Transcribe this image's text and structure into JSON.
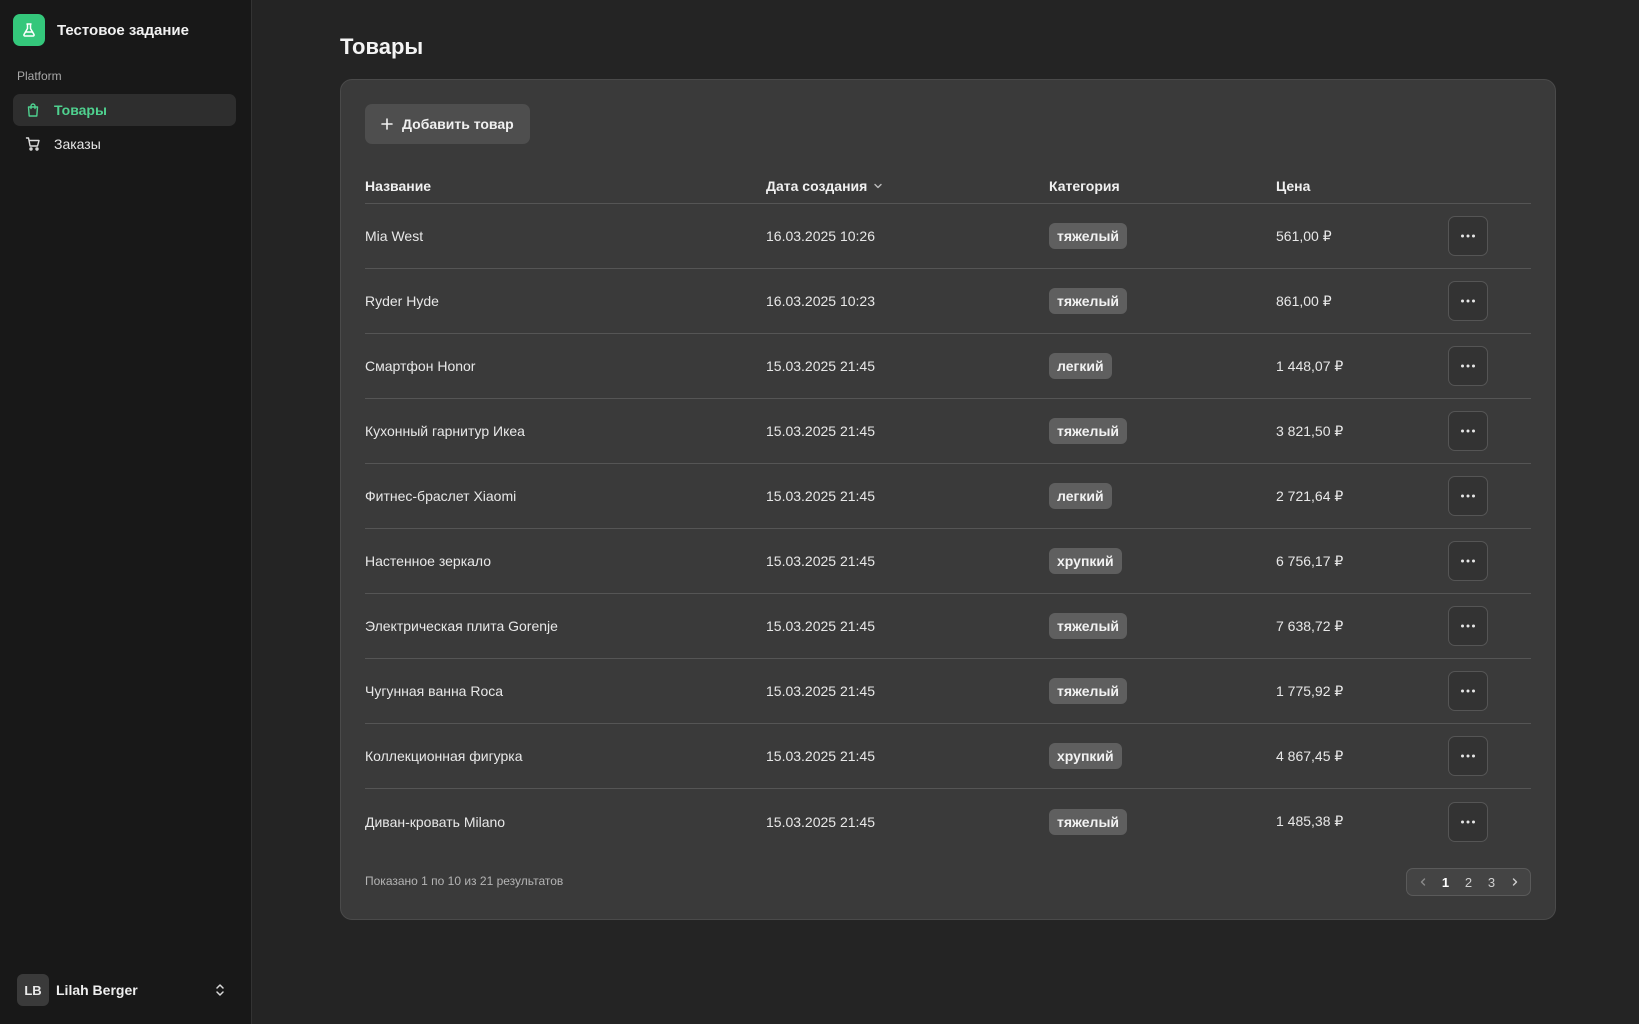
{
  "app": {
    "title": "Тестовое задание"
  },
  "sidebar": {
    "section_label": "Platform",
    "items": [
      {
        "label": "Товары",
        "icon": "shopping-bag-icon",
        "active": true
      },
      {
        "label": "Заказы",
        "icon": "shopping-cart-icon",
        "active": false
      }
    ],
    "user": {
      "initials": "LB",
      "name": "Lilah Berger"
    }
  },
  "main": {
    "title": "Товары",
    "add_button_label": "Добавить товар",
    "columns": {
      "name": "Название",
      "date": "Дата создания",
      "category": "Категория",
      "price": "Цена"
    },
    "rows": [
      {
        "name": "Mia West",
        "date": "16.03.2025 10:26",
        "category": "тяжелый",
        "price": "561,00 ₽"
      },
      {
        "name": "Ryder Hyde",
        "date": "16.03.2025 10:23",
        "category": "тяжелый",
        "price": "861,00 ₽"
      },
      {
        "name": "Смартфон Honor",
        "date": "15.03.2025 21:45",
        "category": "легкий",
        "price": "1 448,07 ₽"
      },
      {
        "name": "Кухонный гарнитур Икеа",
        "date": "15.03.2025 21:45",
        "category": "тяжелый",
        "price": "3 821,50 ₽"
      },
      {
        "name": "Фитнес-браслет Xiaomi",
        "date": "15.03.2025 21:45",
        "category": "легкий",
        "price": "2 721,64 ₽"
      },
      {
        "name": "Настенное зеркало",
        "date": "15.03.2025 21:45",
        "category": "хрупкий",
        "price": "6 756,17 ₽"
      },
      {
        "name": "Электрическая плита Gorenje",
        "date": "15.03.2025 21:45",
        "category": "тяжелый",
        "price": "7 638,72 ₽"
      },
      {
        "name": "Чугунная ванна Roca",
        "date": "15.03.2025 21:45",
        "category": "тяжелый",
        "price": "1 775,92 ₽"
      },
      {
        "name": "Коллекционная фигурка",
        "date": "15.03.2025 21:45",
        "category": "хрупкий",
        "price": "4 867,45 ₽"
      },
      {
        "name": "Диван-кровать Milano",
        "date": "15.03.2025 21:45",
        "category": "тяжелый",
        "price": "1 485,38 ₽"
      }
    ],
    "footer_text": "Показано 1 по 10 из 21 результатов",
    "pagination": {
      "pages": [
        "1",
        "2",
        "3"
      ],
      "current": "1"
    }
  },
  "colors": {
    "accent": "#34c77b",
    "accent_text": "#4fd18f"
  }
}
